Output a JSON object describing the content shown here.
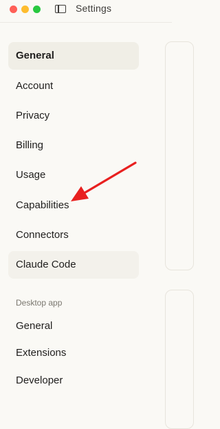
{
  "window": {
    "title": "Settings",
    "icons": {
      "close": "close-button-red",
      "minimize": "minimize-button-yellow",
      "zoom": "zoom-button-green",
      "sidebar_toggle": "sidebar-toggle-icon"
    }
  },
  "sidebar": {
    "items": [
      {
        "label": "General",
        "active": true
      },
      {
        "label": "Account"
      },
      {
        "label": "Privacy"
      },
      {
        "label": "Billing"
      },
      {
        "label": "Usage"
      },
      {
        "label": "Capabilities"
      },
      {
        "label": "Connectors"
      },
      {
        "label": "Claude Code",
        "hovered": true
      }
    ],
    "desktop_section": {
      "label": "Desktop app",
      "items": [
        {
          "label": "General"
        },
        {
          "label": "Extensions"
        },
        {
          "label": "Developer"
        }
      ]
    }
  },
  "annotation": {
    "type": "arrow",
    "color": "#e8201f",
    "points_to": "Capabilities"
  }
}
